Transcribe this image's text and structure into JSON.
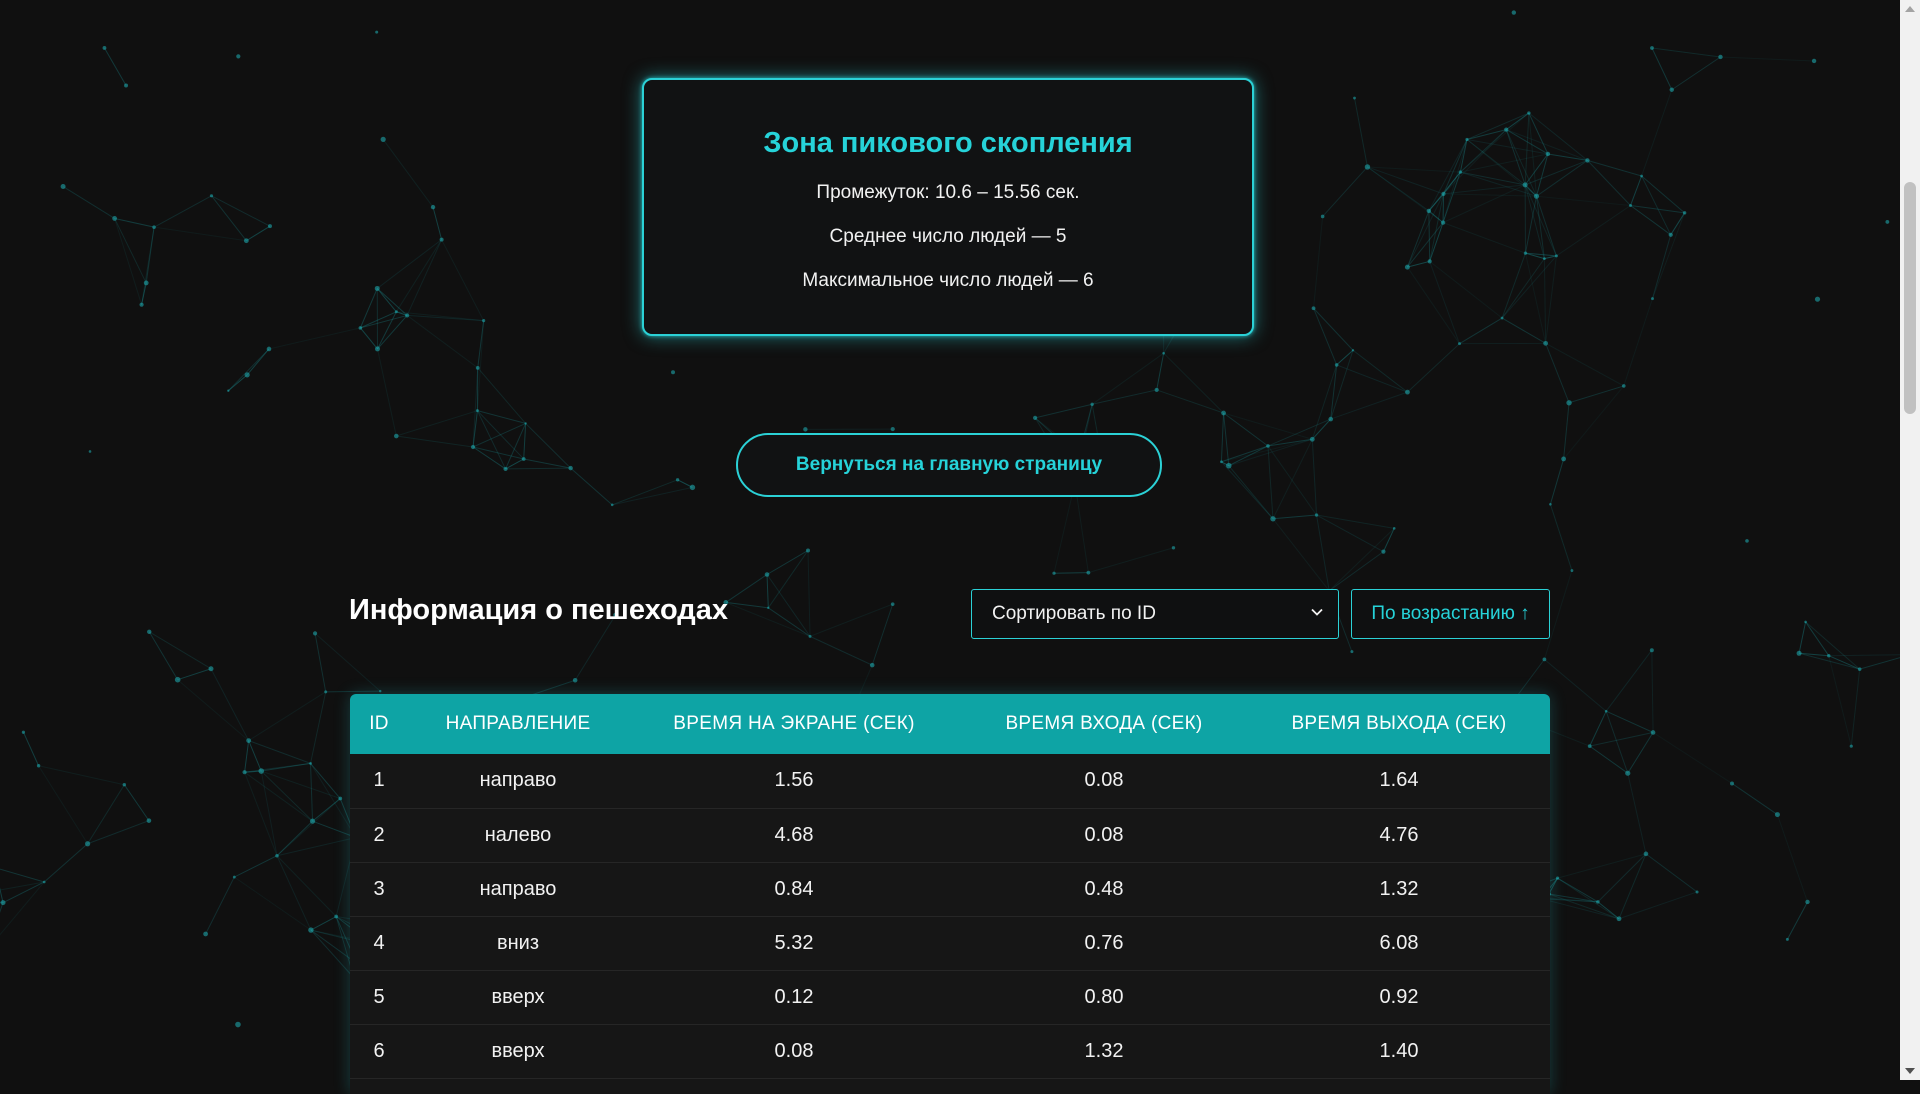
{
  "peak": {
    "title": "Зона пикового скопления",
    "interval": "Промежуток: 10.6 – 15.56 сек.",
    "average": "Среднее число людей — 5",
    "maximum": "Максимальное число людей — 6"
  },
  "home_button": "Вернуться на главную страницу",
  "pedestrians": {
    "title": "Информация о пешеходах",
    "sort_select": "Сортировать по ID",
    "order_button": "По возрастанию ↑",
    "columns": [
      "ID",
      "НАПРАВЛЕНИЕ",
      "ВРЕМЯ НА ЭКРАНЕ (СЕК)",
      "ВРЕМЯ ВХОДА (СЕК)",
      "ВРЕМЯ ВЫХОДА (СЕК)"
    ],
    "rows": [
      [
        "1",
        "направо",
        "1.56",
        "0.08",
        "1.64"
      ],
      [
        "2",
        "налево",
        "4.68",
        "0.08",
        "4.76"
      ],
      [
        "3",
        "направо",
        "0.84",
        "0.48",
        "1.32"
      ],
      [
        "4",
        "вниз",
        "5.32",
        "0.76",
        "6.08"
      ],
      [
        "5",
        "вверх",
        "0.12",
        "0.80",
        "0.92"
      ],
      [
        "6",
        "вверх",
        "0.08",
        "1.32",
        "1.40"
      ]
    ]
  },
  "colors": {
    "accent": "#26d3d9",
    "table_header": "#0ea4a5",
    "background": "#101010"
  },
  "icons": {
    "select_chevron": "chevron-down-icon"
  }
}
